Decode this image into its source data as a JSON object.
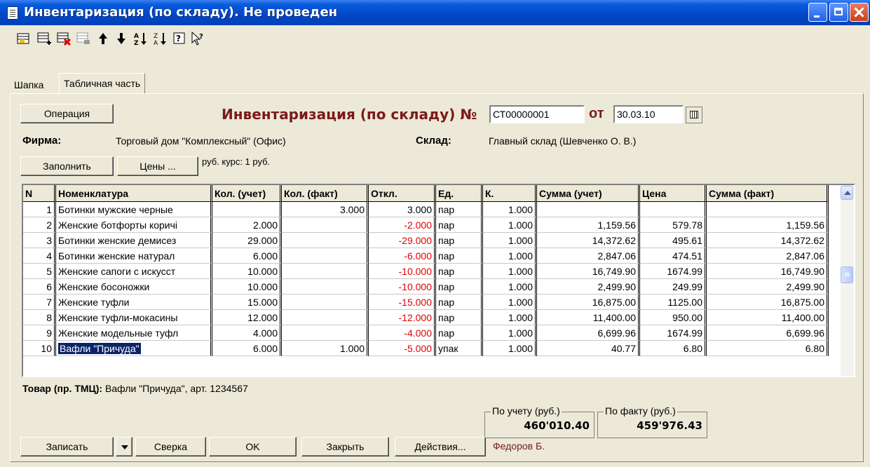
{
  "window": {
    "title": "Инвентаризация (по складу). Не проведен"
  },
  "tabs": [
    {
      "label": "Шапка"
    },
    {
      "label": "Табличная часть"
    }
  ],
  "header": {
    "operation_button": "Операция",
    "doc_title": "Инвентаризация (по складу) №",
    "doc_number": "СТ00000001",
    "date_label": "от",
    "date_value": "30.03.10",
    "firm_label": "Фирма:",
    "firm_value": "Торговый дом \"Комплексный\" (Офис)",
    "warehouse_label": "Склад:",
    "warehouse_value": "Главный склад (Шевченко О. В.)",
    "fill_button": "Заполнить",
    "prices_button": "Цены ...",
    "currency_text": "руб. курс: 1 руб."
  },
  "table": {
    "columns": [
      "N",
      "Номенклатура",
      "Кол. (учет)",
      "Кол. (факт)",
      "Откл.",
      "Ед.",
      "К.",
      "Сумма (учет)",
      "Цена",
      "Сумма (факт)"
    ],
    "rows": [
      [
        "1",
        "Ботинки мужские черные",
        "",
        "3.000",
        "3.000",
        "пар",
        "1.000",
        "",
        "",
        ""
      ],
      [
        "2",
        "Женские ботфорты коричі",
        "2.000",
        "",
        "-2.000",
        "пар",
        "1.000",
        "1,159.56",
        "579.78",
        "1,159.56"
      ],
      [
        "3",
        "Ботинки женские демисез",
        "29.000",
        "",
        "-29.000",
        "пар",
        "1.000",
        "14,372.62",
        "495.61",
        "14,372.62"
      ],
      [
        "4",
        "Ботинки женские натурал",
        "6.000",
        "",
        "-6.000",
        "пар",
        "1.000",
        "2,847.06",
        "474.51",
        "2,847.06"
      ],
      [
        "5",
        "Женские сапоги с искусст",
        "10.000",
        "",
        "-10.000",
        "пар",
        "1.000",
        "16,749.90",
        "1674.99",
        "16,749.90"
      ],
      [
        "6",
        "Женские босоножки",
        "10.000",
        "",
        "-10.000",
        "пар",
        "1.000",
        "2,499.90",
        "249.99",
        "2,499.90"
      ],
      [
        "7",
        "Женские туфли",
        "15.000",
        "",
        "-15.000",
        "пар",
        "1.000",
        "16,875.00",
        "1125.00",
        "16,875.00"
      ],
      [
        "8",
        "Женские туфли-мокасины",
        "12.000",
        "",
        "-12.000",
        "пар",
        "1.000",
        "11,400.00",
        "950.00",
        "11,400.00"
      ],
      [
        "9",
        "Женские модельные туфл",
        "4.000",
        "",
        "-4.000",
        "пар",
        "1.000",
        "6,699.96",
        "1674.99",
        "6,699.96"
      ],
      [
        "10",
        "Вафли \"Причуда\"",
        "6.000",
        "1.000",
        "-5.000",
        "упак",
        "1.000",
        "40.77",
        "6.80",
        "6.80"
      ]
    ],
    "selected_row": 10
  },
  "footer": {
    "product_label": "Товар (пр. ТМЦ):",
    "product_value": "Вафли \"Причуда\", арт. 1234567",
    "total_account_label": "По учету (руб.)",
    "total_account_value": "460'010.40",
    "total_fact_label": "По факту (руб.)",
    "total_fact_value": "459'976.43",
    "save_button": "Записать",
    "verify_button": "Сверка",
    "ok_button": "OK",
    "close_button": "Закрыть",
    "actions_button": "Действия...",
    "author": "Федоров Б."
  },
  "colors": {
    "title_accent": "#7a1a1a",
    "negative": "#e00000",
    "selection": "#0a246a"
  }
}
